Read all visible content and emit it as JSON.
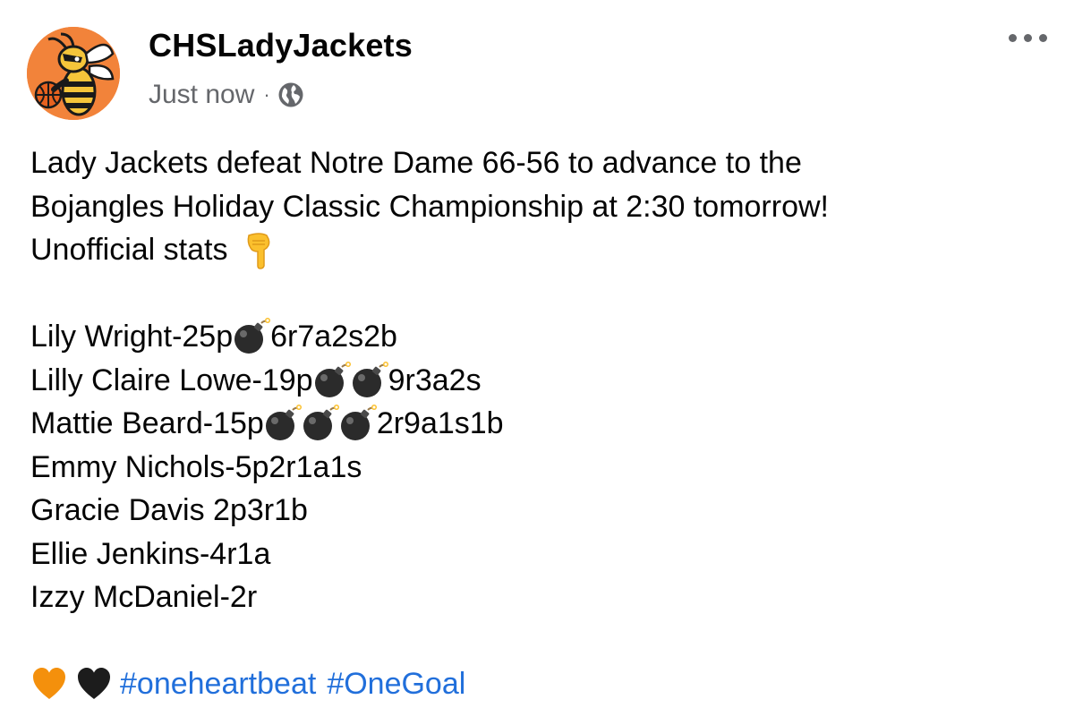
{
  "post": {
    "author": "CHSLadyJackets",
    "timestamp": "Just now",
    "separator": "·",
    "audience_icon": "globe-icon",
    "more_icon": "more-options-icon",
    "text_lines": [
      "Lady Jackets defeat Notre Dame 66-56 to advance to the",
      "Bojangles Holiday Classic Championship at 2:30 tomorrow!",
      "Unofficial stats"
    ],
    "stats": [
      {
        "name_pts": "Lily Wright-25p",
        "bombs": 1,
        "rest": "6r7a2s2b"
      },
      {
        "name_pts": "Lilly Claire Lowe-19p",
        "bombs": 2,
        "rest": "9r3a2s"
      },
      {
        "name_pts": "Mattie Beard-15p",
        "bombs": 3,
        "rest": "2r9a1s1b"
      },
      {
        "name_pts": "Emmy Nichols-5p2r1a1s",
        "bombs": 0,
        "rest": ""
      },
      {
        "name_pts": "Gracie Davis 2p3r1b",
        "bombs": 0,
        "rest": ""
      },
      {
        "name_pts": "Ellie Jenkins-4r1a",
        "bombs": 0,
        "rest": ""
      },
      {
        "name_pts": "Izzy McDaniel-2r",
        "bombs": 0,
        "rest": ""
      }
    ],
    "hashtags": [
      "#oneheartbeat",
      "#OneGoal"
    ]
  },
  "colors": {
    "hashtag": "#216fdb",
    "meta_text": "#65676b",
    "avatar_bg": "#f2833a",
    "orange_heart": "#f4900c",
    "black_heart": "#1c1c1c"
  }
}
